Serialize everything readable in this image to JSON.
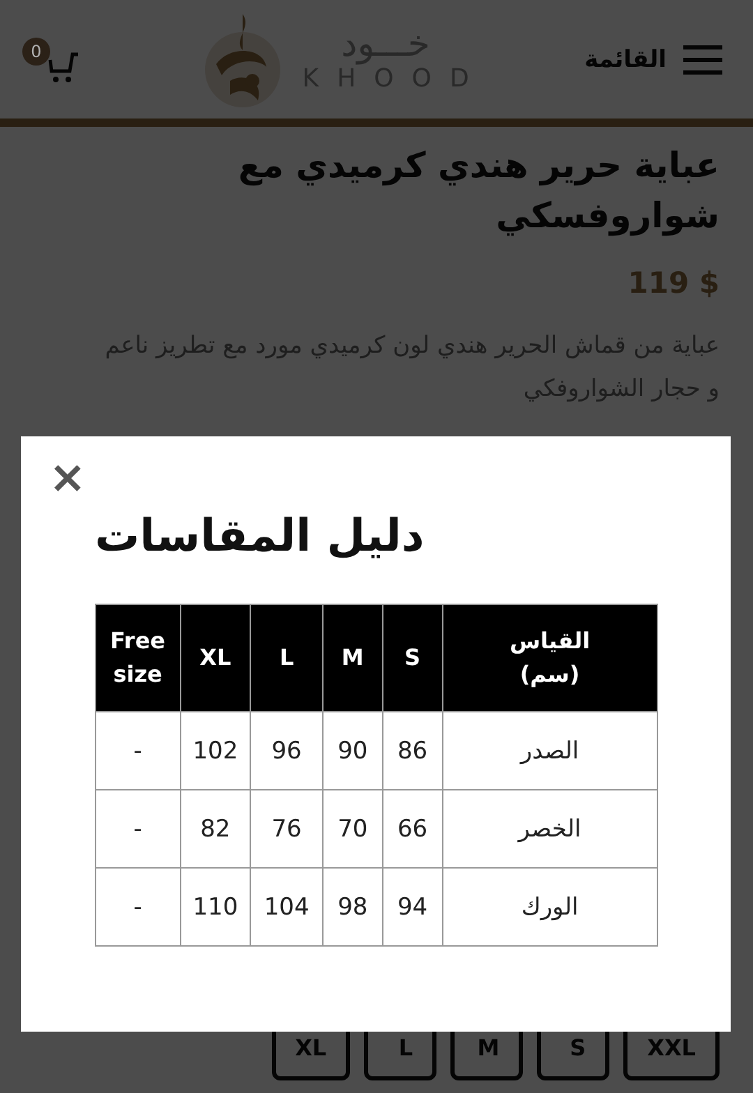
{
  "header": {
    "menu_label": "القائمة",
    "logo_arabic": "خـــود",
    "logo_latin": "KHOOD",
    "cart_count": "0"
  },
  "product": {
    "title": "عباية حرير هندي كرميدي مع شواروفسكي",
    "price": "119 $",
    "description": "عباية من قماش الحرير هندي لون كرميدي مورد مع تطريز ناعم و حجار الشواروفكي",
    "sizes": [
      {
        "label": "XXL"
      },
      {
        "label": "S"
      },
      {
        "label": "M"
      },
      {
        "label": "L"
      },
      {
        "label": "XL"
      }
    ]
  },
  "modal": {
    "close": "×",
    "title": "دليل المقاسات",
    "columns": [
      "القياس (سم)",
      "S",
      "M",
      "L",
      "XL",
      "Free size"
    ],
    "rows": [
      [
        "الصدر",
        "86",
        "90",
        "96",
        "102",
        "-"
      ],
      [
        "الخصر",
        "66",
        "70",
        "76",
        "82",
        "-"
      ],
      [
        "الورك",
        "94",
        "98",
        "104",
        "110",
        "-"
      ]
    ]
  }
}
